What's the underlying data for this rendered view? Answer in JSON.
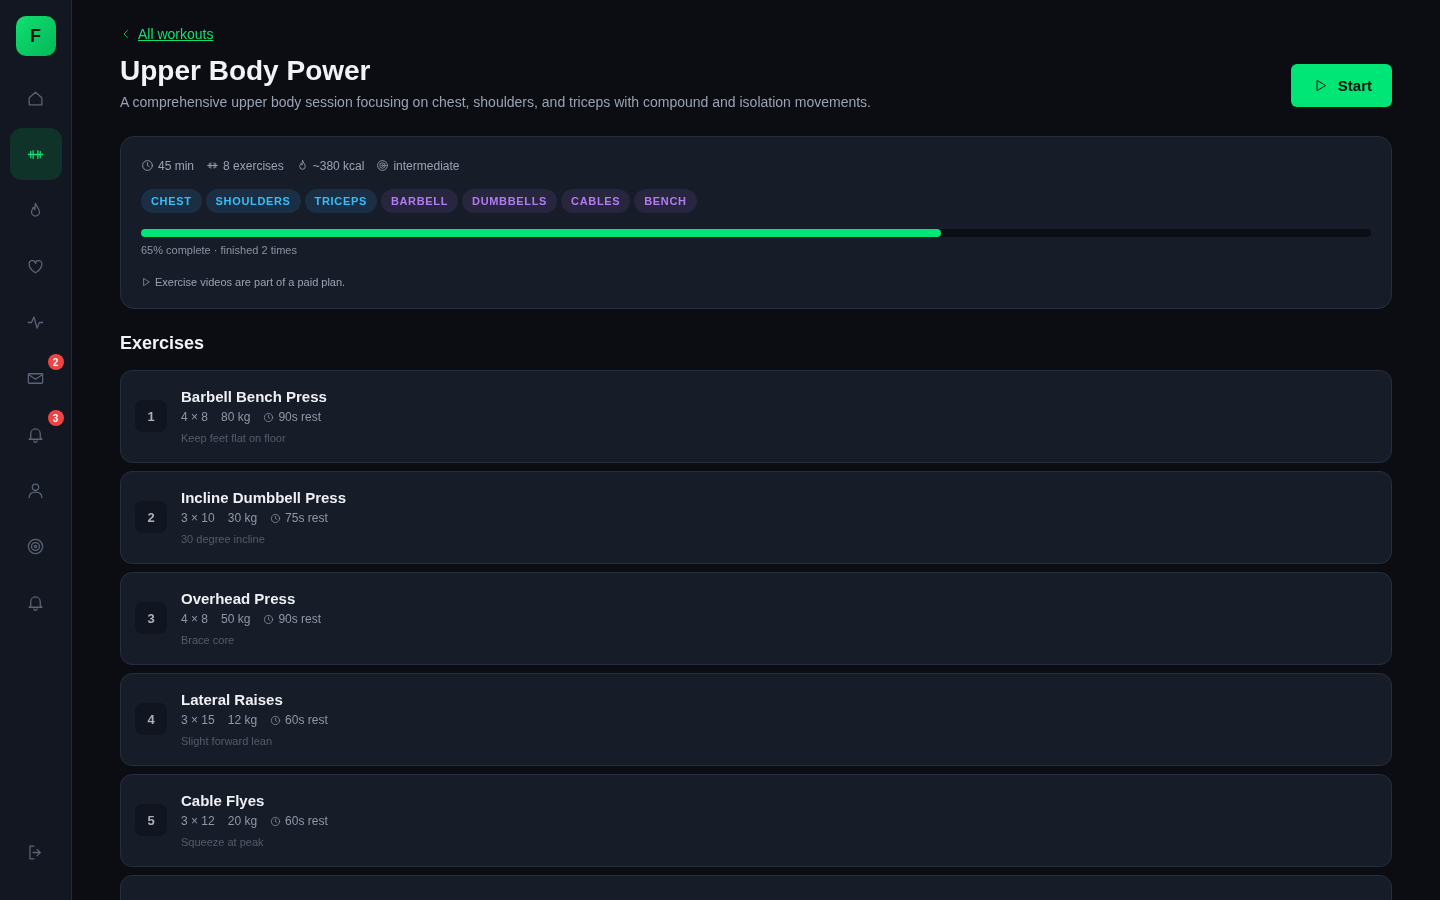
{
  "sidebar": {
    "logo": "F",
    "items": [
      {
        "kind": "home",
        "selected": false
      },
      {
        "kind": "dumbbell",
        "selected": true
      },
      {
        "kind": "flame",
        "selected": false
      },
      {
        "kind": "heart",
        "selected": false
      },
      {
        "kind": "activity",
        "selected": false
      },
      {
        "kind": "mail",
        "selected": false,
        "badge": "2"
      },
      {
        "kind": "bell",
        "selected": false,
        "badge": "3"
      },
      {
        "kind": "user",
        "selected": false
      },
      {
        "kind": "target",
        "selected": false
      },
      {
        "kind": "bell",
        "selected": false
      }
    ]
  },
  "back_link": "All workouts",
  "title": "Upper Body Power",
  "description": "A comprehensive upper body session focusing on chest, shoulders, and triceps with compound and isolation movements.",
  "start_button": "Start",
  "summary": {
    "meta": [
      {
        "kind": "clock",
        "text": "45 min"
      },
      {
        "kind": "dumbbell",
        "text": "8 exercises"
      },
      {
        "kind": "flame",
        "text": "~380 kcal"
      },
      {
        "kind": "target",
        "text": "intermediate"
      }
    ],
    "tags": [
      {
        "label": "CHEST",
        "kind": "muscle"
      },
      {
        "label": "SHOULDERS",
        "kind": "muscle"
      },
      {
        "label": "TRICEPS",
        "kind": "muscle"
      },
      {
        "label": "BARBELL",
        "kind": "equipment"
      },
      {
        "label": "DUMBBELLS",
        "kind": "equipment"
      },
      {
        "label": "CABLES",
        "kind": "equipment"
      },
      {
        "label": "BENCH",
        "kind": "equipment"
      }
    ],
    "progress": {
      "level": 0.65
    },
    "progress_text": "65% complete · finished 2 times",
    "video_note": "Exercise videos are part of a paid plan."
  },
  "exercises_heading": "Exercises",
  "exercises": [
    {
      "number": "1",
      "name": "Barbell Bench Press",
      "sets": "4 × 8",
      "weight": "80 kg",
      "rest": "90s rest",
      "note": "Keep feet flat on floor"
    },
    {
      "number": "2",
      "name": "Incline Dumbbell Press",
      "sets": "3 × 10",
      "weight": "30 kg",
      "rest": "75s rest",
      "note": "30 degree incline"
    },
    {
      "number": "3",
      "name": "Overhead Press",
      "sets": "4 × 8",
      "weight": "50 kg",
      "rest": "90s rest",
      "note": "Brace core"
    },
    {
      "number": "4",
      "name": "Lateral Raises",
      "sets": "3 × 15",
      "weight": "12 kg",
      "rest": "60s rest",
      "note": "Slight forward lean"
    },
    {
      "number": "5",
      "name": "Cable Flyes",
      "sets": "3 × 12",
      "weight": "20 kg",
      "rest": "60s rest",
      "note": "Squeeze at peak"
    }
  ]
}
